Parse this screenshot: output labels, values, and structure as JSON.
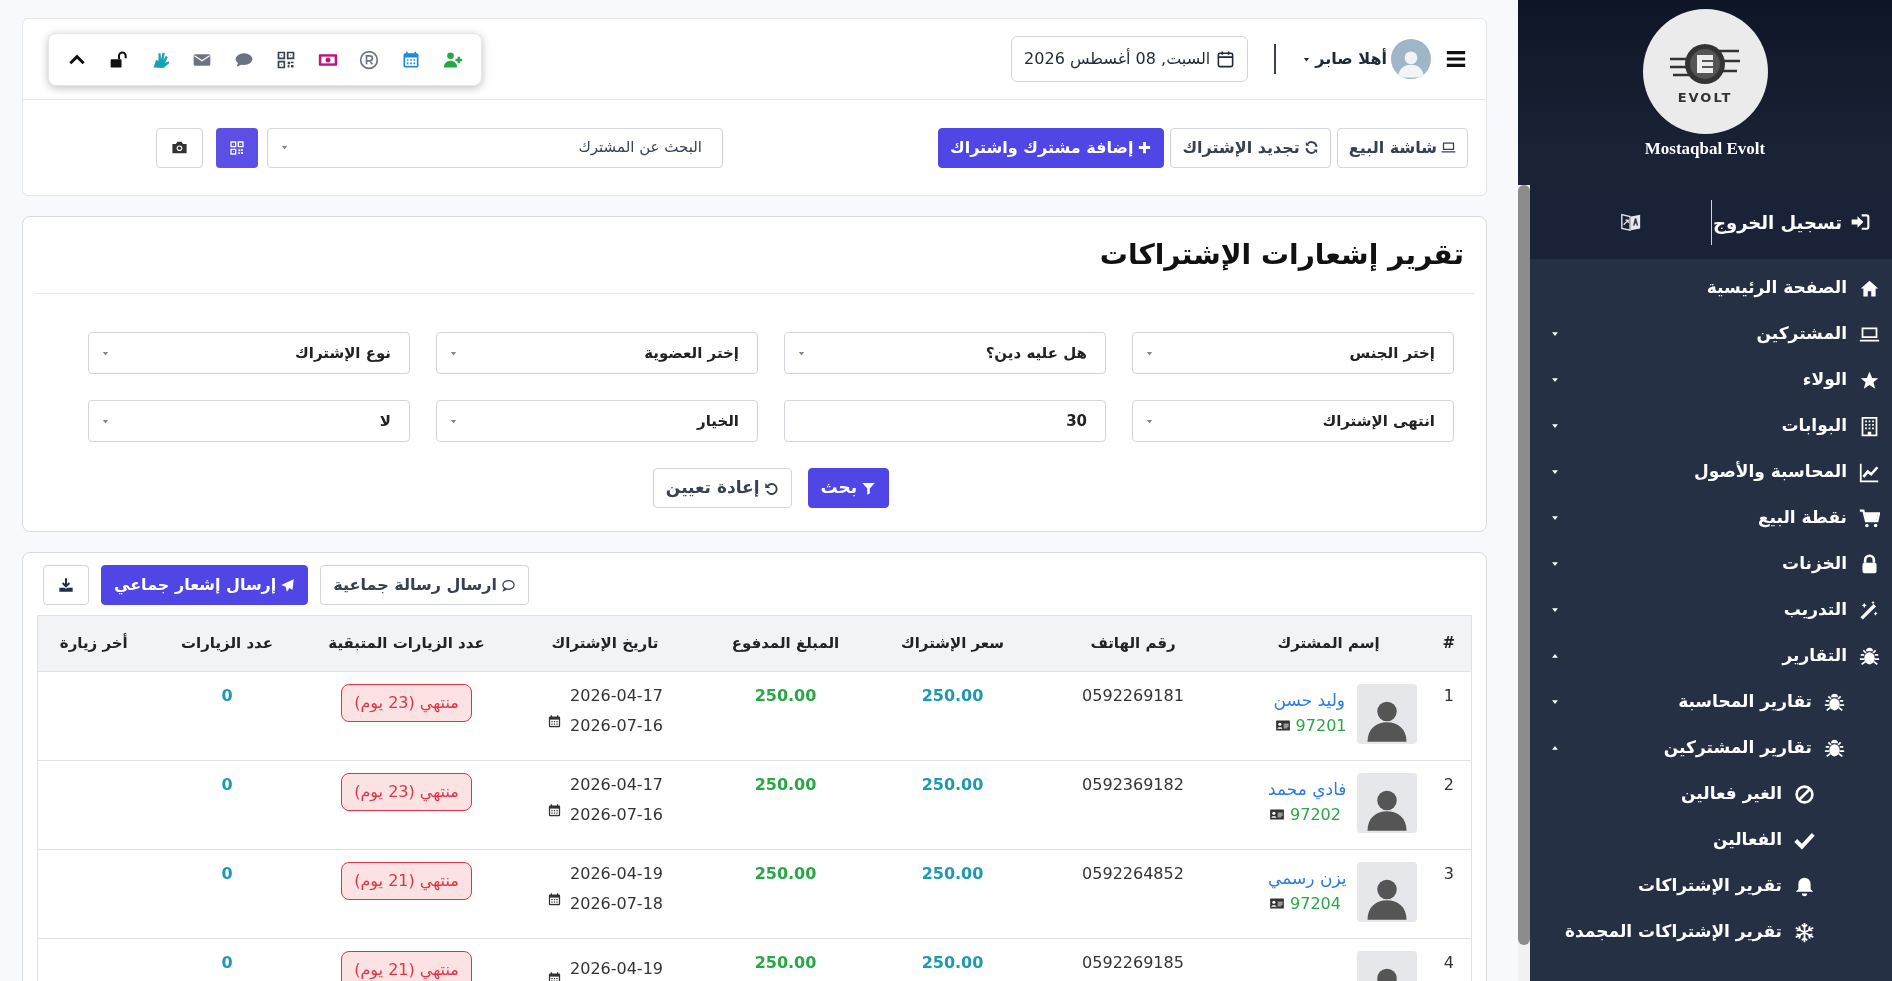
{
  "header": {
    "user_name": "أهلا صابر",
    "date": "السبت, 08 أغسطس 2026"
  },
  "actions": [
    {
      "label": "شاشة البيع",
      "kind": "outline"
    },
    {
      "label": "تجديد الإشتراك",
      "kind": "outline"
    },
    {
      "label": "إضافة مشترك واشتراك",
      "kind": "primary"
    }
  ],
  "subscriber_search": {
    "placeholder": "البحث عن المشترك"
  },
  "report": {
    "title": "تقرير إشعارات الإشتراكات",
    "filters": [
      {
        "kind": "select",
        "value": "إختر الجنس"
      },
      {
        "kind": "select",
        "value": "هل عليه دين؟"
      },
      {
        "kind": "select",
        "value": "إختر العضوية"
      },
      {
        "kind": "select",
        "value": "نوع الإشتراك"
      },
      {
        "kind": "select",
        "value": "انتهى الإشتراك"
      },
      {
        "kind": "input",
        "value": "30"
      },
      {
        "kind": "select",
        "value": "الخيار"
      },
      {
        "kind": "select",
        "value": "لا"
      }
    ],
    "buttons": [
      {
        "label": "بحث",
        "kind": "primary"
      },
      {
        "label": "إعادة تعيين",
        "kind": "outline"
      }
    ]
  },
  "table_actions": [
    {
      "label": "ارسال رسالة جماعية",
      "kind": "outline"
    },
    {
      "label": "إرسال إشعار جماعي",
      "kind": "primary"
    }
  ],
  "table": {
    "columns": [
      "#",
      "إسم المشترك",
      "رقم الهاتف",
      "سعر الإشتراك",
      "المبلغ المدفوع",
      "تاريخ الإشتراك",
      "عدد الزيارات المتبقية",
      "عدد الزيارات",
      "أخر زيارة"
    ],
    "rows": [
      {
        "index": "1",
        "name": "وليد حسن",
        "member_id": "97201",
        "phone": "0592269181",
        "price": "250.00",
        "paid": "250.00",
        "start_date": "2026-04-17",
        "end_date": "2026-07-16",
        "remaining": "منتهي (23 يوم)",
        "visits": "0"
      },
      {
        "index": "2",
        "name": "فادي محمد",
        "member_id": "97202",
        "phone": "0592369182",
        "price": "250.00",
        "paid": "250.00",
        "start_date": "2026-04-17",
        "end_date": "2026-07-16",
        "remaining": "منتهي (23 يوم)",
        "visits": "0"
      },
      {
        "index": "3",
        "name": "يزن رسمي",
        "member_id": "97204",
        "phone": "0592264852",
        "price": "250.00",
        "paid": "250.00",
        "start_date": "2026-04-19",
        "end_date": "2026-07-18",
        "remaining": "منتهي (21 يوم)",
        "visits": "0"
      },
      {
        "index": "4",
        "phone": "0592269185",
        "price": "250.00",
        "paid": "250.00",
        "start_date": "2026-04-19",
        "remaining": "منتهي (21 يوم)",
        "visits": "0"
      }
    ]
  },
  "sidebar": {
    "logo_text": "EVOLT",
    "brand": "Mostaqbal Evolt",
    "logout": "تسجيل الخروج",
    "items": [
      {
        "label": "الصفحة الرئيسية"
      },
      {
        "label": "المشتركين",
        "expanded": false
      },
      {
        "label": "الولاء",
        "expanded": false
      },
      {
        "label": "البوابات",
        "expanded": false
      },
      {
        "label": "المحاسبة والأصول",
        "expanded": false
      },
      {
        "label": "نقطة البيع",
        "expanded": false
      },
      {
        "label": "الخزنات",
        "expanded": false
      },
      {
        "label": "التدريب",
        "expanded": false
      },
      {
        "label": "التقارير",
        "expanded": true,
        "children": [
          {
            "label": "تقارير المحاسبة",
            "expanded": false
          },
          {
            "label": "تقارير المشتركين",
            "expanded": true,
            "children": [
              {
                "label": "الغير فعالين"
              },
              {
                "label": "الفعالين"
              },
              {
                "label": "تقرير الإشتراكات"
              },
              {
                "label": "تقرير الإشتراكات المجمدة"
              }
            ]
          }
        ]
      }
    ]
  }
}
